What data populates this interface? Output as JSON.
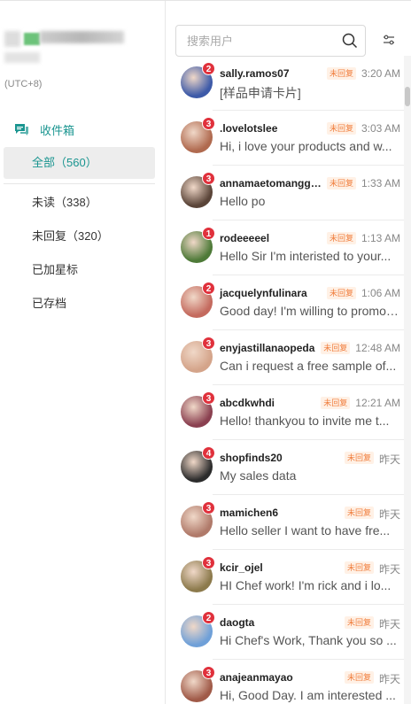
{
  "account": {
    "timezone": "(UTC+8)"
  },
  "nav": {
    "inbox_label": "收件箱",
    "items": [
      {
        "label": "全部（560）",
        "active": true
      },
      {
        "label": "未读（338）"
      },
      {
        "label": "未回复（320）"
      },
      {
        "label": "已加星标"
      },
      {
        "label": "已存档"
      }
    ]
  },
  "search": {
    "placeholder": "搜索用户"
  },
  "colors": {
    "accent": "#1a9590",
    "badge": "#e0313c",
    "tag_text": "#f07d3c",
    "tag_bg": "#fff1e6"
  },
  "conversations": [
    {
      "username": "sally.ramos07",
      "badge": "2",
      "tag": "未回复",
      "time": "3:20 AM",
      "message": "[样品申请卡片]",
      "avatar_color": "#3d5aa8"
    },
    {
      "username": ".lovelotslee",
      "badge": "3",
      "tag": "未回复",
      "time": "3:03 AM",
      "message": "Hi, i love your products and w...",
      "avatar_color": "#b06a4f"
    },
    {
      "username": "annamaetomanggo...",
      "badge": "3",
      "tag": "未回复",
      "time": "1:33 AM",
      "message": "Hello po",
      "avatar_color": "#5a4438"
    },
    {
      "username": "rodeeeeel",
      "badge": "1",
      "tag": "未回复",
      "time": "1:13 AM",
      "message": "Hello Sir I'm interisted to your...",
      "avatar_color": "#4e7a38"
    },
    {
      "username": "jacquelynfulinara",
      "badge": "2",
      "tag": "未回复",
      "time": "1:06 AM",
      "message": "Good day! I'm willing to promote...",
      "avatar_color": "#c46a5e"
    },
    {
      "username": "enyjastillanaopeda",
      "badge": "3",
      "tag": "未回复",
      "time": "12:48 AM",
      "message": "Can i request a free sample of...",
      "avatar_color": "#d4a48a"
    },
    {
      "username": "abcdkwhdi",
      "badge": "3",
      "tag": "未回复",
      "time": "12:21 AM",
      "message": "Hello! thankyou to invite me t...",
      "avatar_color": "#8a4050"
    },
    {
      "username": "shopfinds20",
      "badge": "4",
      "tag": "未回复",
      "time": "昨天",
      "message": "My sales data",
      "avatar_color": "#2c2c2c"
    },
    {
      "username": "mamichen6",
      "badge": "3",
      "tag": "未回复",
      "time": "昨天",
      "message": "Hello seller I want to have fre...",
      "avatar_color": "#b07a6a"
    },
    {
      "username": "kcir_ojel",
      "badge": "3",
      "tag": "未回复",
      "time": "昨天",
      "message": "HI Chef work! I'm rick and i lo...",
      "avatar_color": "#8c7a4c"
    },
    {
      "username": "daogta",
      "badge": "2",
      "tag": "未回复",
      "time": "昨天",
      "message": "Hi Chef's Work, Thank you so ...",
      "avatar_color": "#6fa0d8"
    },
    {
      "username": "anajeanmayao",
      "badge": "3",
      "tag": "未回复",
      "time": "昨天",
      "message": "Hi, Good Day. I am interested ...",
      "avatar_color": "#a05a48"
    }
  ]
}
